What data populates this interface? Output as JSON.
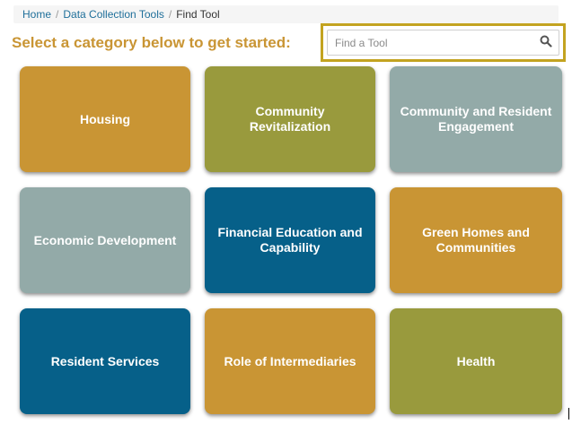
{
  "breadcrumb": {
    "items": [
      {
        "label": "Home"
      },
      {
        "label": "Data Collection Tools"
      },
      {
        "label": "Find Tool"
      }
    ],
    "separator": "/"
  },
  "heading": "Select a category below to get started:",
  "search": {
    "placeholder": "Find a Tool",
    "value": "",
    "icon": "search-icon",
    "highlight_color": "#c3a320"
  },
  "categories": [
    {
      "label": "Housing",
      "color": "#c99534"
    },
    {
      "label": "Community Revitalization",
      "color": "#999a3d"
    },
    {
      "label": "Community and Resident Engagement",
      "color": "#93aaa8"
    },
    {
      "label": "Economic Development",
      "color": "#93aaa8"
    },
    {
      "label": "Financial Education and Capability",
      "color": "#066089"
    },
    {
      "label": "Green Homes and Communities",
      "color": "#c99534"
    },
    {
      "label": "Resident Services",
      "color": "#066089"
    },
    {
      "label": "Role of Intermediaries",
      "color": "#c99534"
    },
    {
      "label": "Health",
      "color": "#999a3d"
    }
  ],
  "colors": {
    "heading": "#c99534",
    "link": "#1f6f9a"
  }
}
